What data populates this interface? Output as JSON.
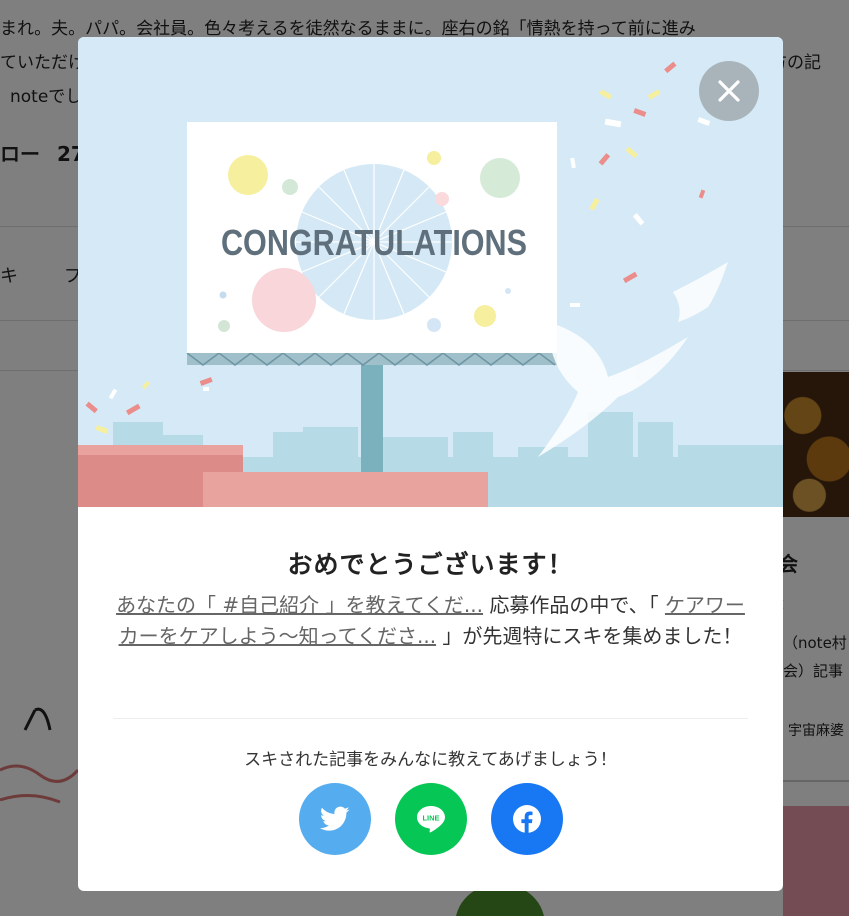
{
  "background": {
    "profile_line1": "まれ。夫。パパ。会社員。色々考えるを徒然なるままに。座右の銘「情熱を持って前に進み",
    "profile_line2_left": "ていただけ",
    "profile_line2_right": "方の記",
    "profile_line3": "noteでし",
    "follow_label": "ロー",
    "follow_count": "27",
    "tab1": "キ",
    "tab2": "フ",
    "right_title": "会",
    "right_sub": "：",
    "right_text1": "（note村",
    "right_text2": "会）記事",
    "right_author": "宇宙麻婆"
  },
  "modal": {
    "hero": {
      "billboard_text": "CONGRATULATIONS"
    },
    "title": "おめでとうございます！",
    "desc": {
      "link1": "あなたの「 #自己紹介 」を教えてくだ...",
      "text1": " 応募作品の中で、「 ",
      "link2": "ケアワーカーをケアしよう〜知ってくださ...",
      "text2": " 」が先週特にスキを集めました！"
    },
    "share_prompt": "スキされた記事をみんなに教えてあげましょう！",
    "share_buttons": {
      "twitter_color": "#55acee",
      "line_color": "#06c755",
      "facebook_color": "#1877f2",
      "line_label": "LINE"
    }
  },
  "colors": {
    "hero_bg": "#d5eaf6",
    "overlay": "rgba(0,0,0,0.5)"
  }
}
